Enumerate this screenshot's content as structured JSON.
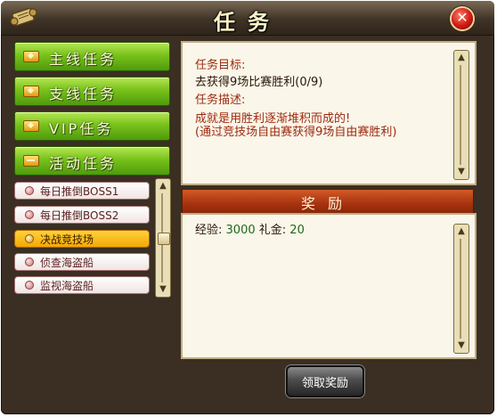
{
  "window": {
    "title": "任务",
    "close_glyph": "✕"
  },
  "categories": [
    {
      "label": "主线任务",
      "icon": "plus-icon"
    },
    {
      "label": "支线任务",
      "icon": "plus-icon"
    },
    {
      "label": "VIP任务",
      "icon": "plus-icon"
    },
    {
      "label": "活动任务",
      "icon": "minus-icon"
    }
  ],
  "sub_tasks": [
    {
      "label": "每日推倒BOSS1",
      "active": false
    },
    {
      "label": "每日推倒BOSS2",
      "active": false
    },
    {
      "label": "决战竞技场",
      "active": true
    },
    {
      "label": "侦查海盗船",
      "active": false
    },
    {
      "label": "监视海盗船",
      "active": false
    }
  ],
  "detail": {
    "goal_heading": "任务目标:",
    "goal_text": "去获得9场比赛胜利(0/9)",
    "desc_heading": "任务描述:",
    "desc_line1": "成就是用胜利逐渐堆积而成的!",
    "desc_line2": "(通过竞技场自由赛获得9场自由赛胜利)"
  },
  "reward": {
    "heading": "奖励",
    "exp_label": "经验:",
    "exp_value": "3000",
    "gift_label": "礼金:",
    "gift_value": "20"
  },
  "claim_button": "领取奖励",
  "colors": {
    "frame": "#3b2e22",
    "green_button": "#78c21b",
    "active_item": "#f3a806",
    "reward_header": "#a8330f"
  }
}
